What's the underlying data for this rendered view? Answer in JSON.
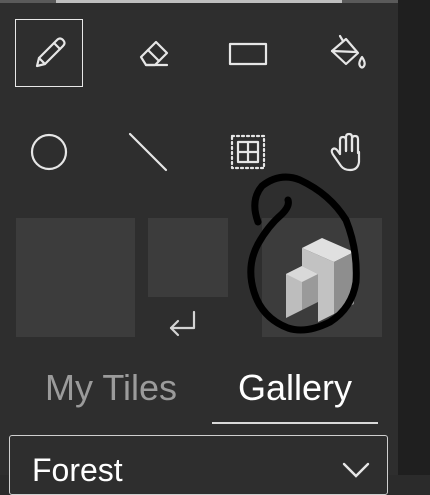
{
  "toolbar": {
    "tools": [
      {
        "icon": "pencil-icon",
        "selected": true
      },
      {
        "icon": "eraser-icon",
        "selected": false
      },
      {
        "icon": "rectangle-icon",
        "selected": false
      },
      {
        "icon": "paint-bucket-icon",
        "selected": false
      },
      {
        "icon": "circle-icon",
        "selected": false
      },
      {
        "icon": "line-icon",
        "selected": false
      },
      {
        "icon": "selection-grid-icon",
        "selected": false
      },
      {
        "icon": "hand-pan-icon",
        "selected": false
      }
    ]
  },
  "tiles": {
    "enter_icon": "return-arrow-icon",
    "selected_tile_icon": "3d-block-icon"
  },
  "tabs": {
    "my_tiles": "My Tiles",
    "gallery": "Gallery",
    "active": "Gallery"
  },
  "gallery_select": {
    "value": "Forest",
    "icon": "chevron-down-icon"
  },
  "colors": {
    "panel": "#2e2e2e",
    "tile": "#3c3c3c",
    "text_active": "#ffffff",
    "text_inactive": "#9b9b9b",
    "annotation": "#000000"
  }
}
